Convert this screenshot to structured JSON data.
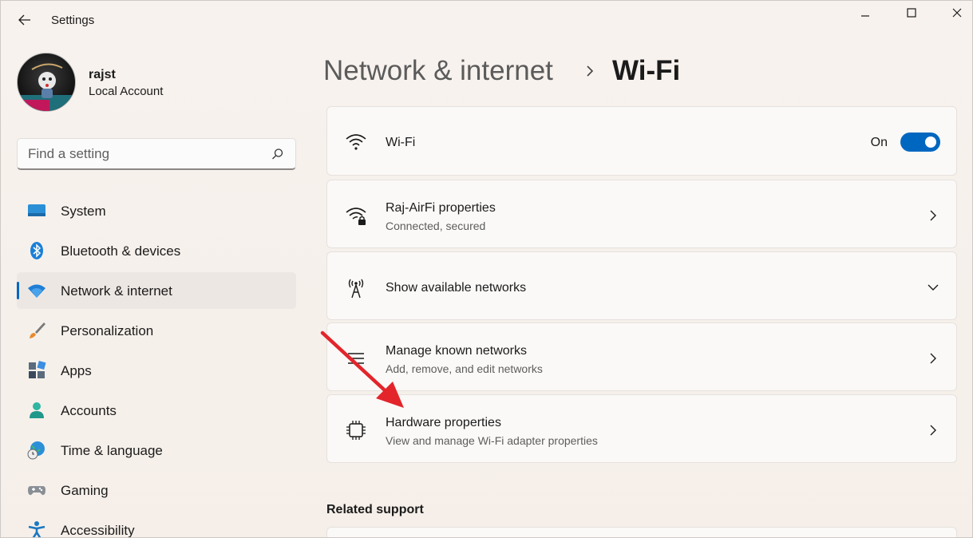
{
  "window": {
    "title": "Settings"
  },
  "profile": {
    "name": "rajst",
    "account_type": "Local Account"
  },
  "search": {
    "placeholder": "Find a setting"
  },
  "sidebar": {
    "items": [
      {
        "label": "System",
        "icon": "system-icon"
      },
      {
        "label": "Bluetooth & devices",
        "icon": "bluetooth-icon"
      },
      {
        "label": "Network & internet",
        "icon": "wifi-icon",
        "active": true
      },
      {
        "label": "Personalization",
        "icon": "brush-icon"
      },
      {
        "label": "Apps",
        "icon": "apps-icon"
      },
      {
        "label": "Accounts",
        "icon": "person-icon"
      },
      {
        "label": "Time & language",
        "icon": "globe-clock-icon"
      },
      {
        "label": "Gaming",
        "icon": "gamepad-icon"
      },
      {
        "label": "Accessibility",
        "icon": "accessibility-icon"
      }
    ]
  },
  "header": {
    "breadcrumb_parent": "Network & internet",
    "breadcrumb_current": "Wi-Fi"
  },
  "cards": {
    "wifi": {
      "title": "Wi-Fi",
      "toggle_state": "On"
    },
    "properties": {
      "title": "Raj-AirFi properties",
      "subtitle": "Connected, secured"
    },
    "available": {
      "title": "Show available networks"
    },
    "known": {
      "title": "Manage known networks",
      "subtitle": "Add, remove, and edit networks"
    },
    "hardware": {
      "title": "Hardware properties",
      "subtitle": "View and manage Wi-Fi adapter properties"
    }
  },
  "related": {
    "heading": "Related support"
  },
  "colors": {
    "accent": "#0067c0",
    "annotation_arrow": "#e3242b"
  }
}
